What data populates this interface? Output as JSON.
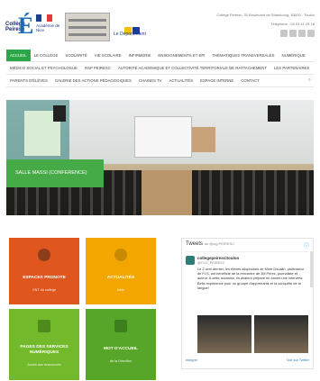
{
  "header": {
    "college_logo_text": "Collège Peiresc",
    "academie_text": "Académie de Nice",
    "dept_text": "Le Département",
    "address": "Collège Peiresc, 31 Boulevard de Strasbourg, 83000 - Toulon",
    "phone": "Téléphone : 04 94 41 28 18"
  },
  "nav": {
    "row1": [
      "ACCUEIL",
      "LE COLLÈGE",
      "SCOLARITÉ",
      "VIE SCOLAIRE",
      "INFIRMERIE",
      "ENSEIGNEMENTS ET EPI",
      "THÉMATIQUES TRANSVERSALES",
      "NUMÉRIQUE"
    ],
    "row2": [
      "MÉDICO SOCIAL ET PSYCHOLOGUE",
      "RSP PEIRESC",
      "AUTORITÉ ACADÉMIQUE ET COLLECTIVITÉ TERRITORIALE DE RATTACHEMENT",
      "LES PARTENAIRES"
    ],
    "row3": [
      "PARENTS D'ÉLÈVES",
      "GALERIE DES ACTIONS PÉDAGOGIQUES",
      "CHAINES TV",
      "ACTUALITÉS",
      "ESPACE INTERNE",
      "CONTACT"
    ]
  },
  "hero": {
    "caption": "SALLE MASSI (CONFERENCE)"
  },
  "tiles": [
    {
      "icon": "pronote-icon",
      "title": "ESPACES PRONOTE",
      "sub": "CNT du collège"
    },
    {
      "icon": "check-icon",
      "title": "ACTUALITÉS",
      "sub": "Infos"
    },
    {
      "icon": "computer-icon",
      "title": "PAGES DES SERVICES NUMÉRIQUES",
      "sub": "Accès aux ressources"
    },
    {
      "icon": "document-icon",
      "title": "MOT D'ACCUEIL",
      "sub": "de la Direction"
    }
  ],
  "twitter": {
    "title": "Tweets",
    "by": "de @clg.PEIRESC",
    "user": "collegepeirescitoulon",
    "handle": "@CLG_PEIRESC",
    "text": "Le 2 avril dernier, les élèves allophones de Mme Doualin, professeur de FLS, ont bénéficié de la rencontre de JM Pérez, journaliste et auteur. A cette occasion, ils avaient préparé en amont une interview. Belle expérience pour un groupe d'apprenants et la conquête de la langue!",
    "footer_left": "Intégrer",
    "footer_right": "Voir sur Twitter"
  }
}
